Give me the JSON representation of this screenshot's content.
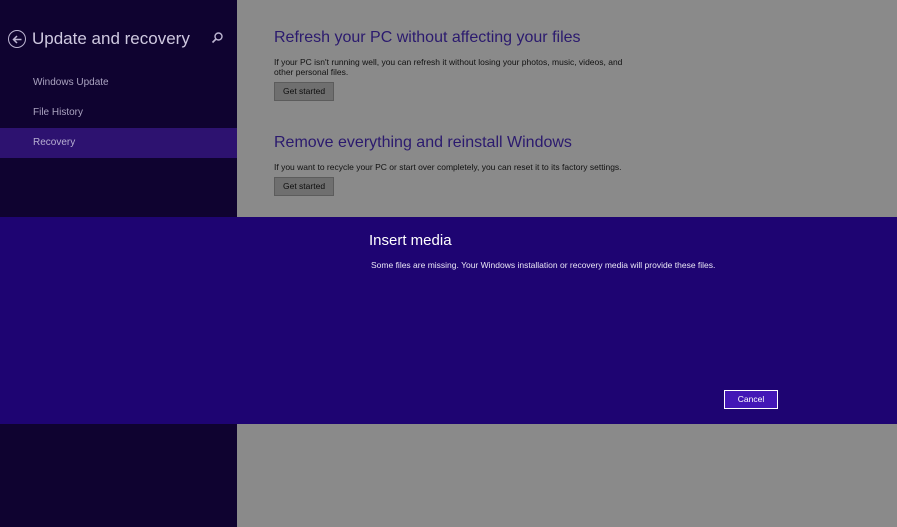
{
  "left_pane": {
    "title": "Update and recovery",
    "back_icon": "back-arrow-icon",
    "search_icon": "search-icon",
    "nav_items": [
      {
        "label": "Windows Update",
        "selected": false
      },
      {
        "label": "File History",
        "selected": false
      },
      {
        "label": "Recovery",
        "selected": true
      }
    ]
  },
  "main": {
    "refresh": {
      "heading": "Refresh your PC without affecting your files",
      "description": "If your PC isn't running well, you can refresh it without losing your photos, music, videos, and other personal files.",
      "button_label": "Get started"
    },
    "reset": {
      "heading": "Remove everything and reinstall Windows",
      "description": "If you want to recycle your PC or start over completely, you can reset it to its factory settings.",
      "button_label": "Get started"
    }
  },
  "dialog": {
    "title": "Insert media",
    "message": "Some files are missing. Your Windows installation or recovery media will provide these files.",
    "cancel_label": "Cancel"
  },
  "colors": {
    "left_pane_bg": "#0f0330",
    "nav_selected_bg": "#2d1270",
    "dialog_bg": "#1e0472",
    "heading_color": "#2b1a6e",
    "dimmed_content_bg": "#8a8a8a"
  }
}
